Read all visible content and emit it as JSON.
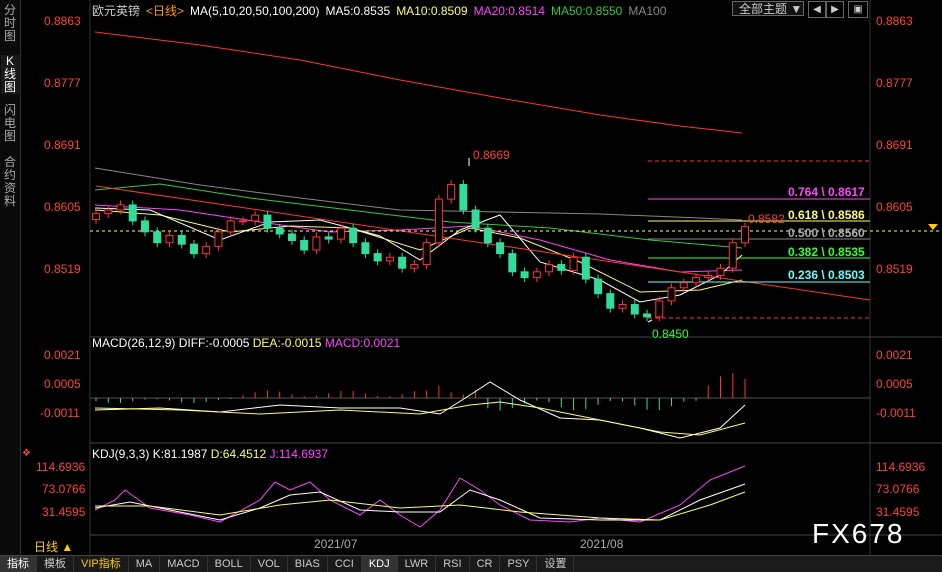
{
  "sidebar": {
    "tabs": [
      {
        "label": "分时图"
      },
      {
        "label": "K线图"
      },
      {
        "label": "闪电图"
      },
      {
        "label": "合约资料"
      }
    ]
  },
  "header": {
    "title": "欧元英镑",
    "period": "<日线>",
    "ma_params": "MA(5,10,20,50,100,200)",
    "ma5": "MA5:0.8535",
    "ma10": "MA10:0.8509",
    "ma20": "MA20:0.8514",
    "ma50": "MA50:0.8550",
    "ma100": "MA100",
    "theme": "全部主题"
  },
  "colors": {
    "ma5": "#ffffff",
    "ma10": "#ffff66",
    "ma20": "#ff44ff",
    "ma50": "#33cc33",
    "ma100": "#888888",
    "ma200": "#ff3333",
    "up": "#ff3333",
    "down": "#33dd99"
  },
  "price_axis": {
    "labels": [
      "0.8863",
      "0.8777",
      "0.8691",
      "0.8605",
      "0.8519"
    ]
  },
  "annotations": {
    "high": "0.8669",
    "low": "0.8450",
    "last": "0.8582"
  },
  "fib": [
    {
      "label": "0.764 \\ 0.8617",
      "color": "#ff44ff"
    },
    {
      "label": "0.618 \\ 0.8586",
      "color": "#ffff66"
    },
    {
      "label": "0.500 \\ 0.8560",
      "color": "#aaaaaa"
    },
    {
      "label": "0.382 \\ 0.8535",
      "color": "#33ff33"
    },
    {
      "label": "0.236 \\ 0.8503",
      "color": "#66ffff"
    }
  ],
  "macd": {
    "title": "MACD(26,12,9)",
    "diff": "DIFF:-0.0005",
    "dea": "DEA:-0.0015",
    "macd": "MACD:0.0021",
    "axis": [
      "0.0021",
      "0.0005",
      "-0.0011"
    ]
  },
  "kdj": {
    "title": "KDJ(9,3,3)",
    "k": "K:81.1987",
    "d": "D:64.4512",
    "j": "J:114.6937",
    "axis_left": [
      "114.6936",
      "73.0766",
      "31.4595"
    ],
    "axis_right": [
      "114.6936",
      "73.0766",
      "31.4595"
    ]
  },
  "x_axis": {
    "labels": [
      "2021/07",
      "2021/08"
    ]
  },
  "period_tab": "日线",
  "bottom_tabs": [
    "指标",
    "模板",
    "VIP指标",
    "MA",
    "MACD",
    "BOLL",
    "VOL",
    "BIAS",
    "CCI",
    "KDJ",
    "LWR",
    "RSI",
    "CR",
    "PSY",
    "设置"
  ],
  "brand": "FX678",
  "chart_data": {
    "type": "candlestick",
    "title": "欧元英镑 <日线>",
    "ylim": [
      0.844,
      0.888
    ],
    "candles_close_approx": [
      0.86,
      0.8605,
      0.8612,
      0.859,
      0.8575,
      0.856,
      0.857,
      0.8558,
      0.8545,
      0.8555,
      0.8575,
      0.859,
      0.859,
      0.8598,
      0.858,
      0.8572,
      0.8563,
      0.855,
      0.8568,
      0.8565,
      0.858,
      0.856,
      0.8545,
      0.8535,
      0.854,
      0.8525,
      0.853,
      0.856,
      0.862,
      0.864,
      0.8605,
      0.858,
      0.856,
      0.8545,
      0.852,
      0.8512,
      0.852,
      0.853,
      0.8522,
      0.854,
      0.851,
      0.849,
      0.847,
      0.8475,
      0.8462,
      0.8458,
      0.848,
      0.8498,
      0.8505,
      0.8512,
      0.8515,
      0.8525,
      0.856,
      0.8582
    ],
    "levels": {
      "high": 0.8669,
      "low": 0.845,
      "last": 0.8582
    }
  }
}
